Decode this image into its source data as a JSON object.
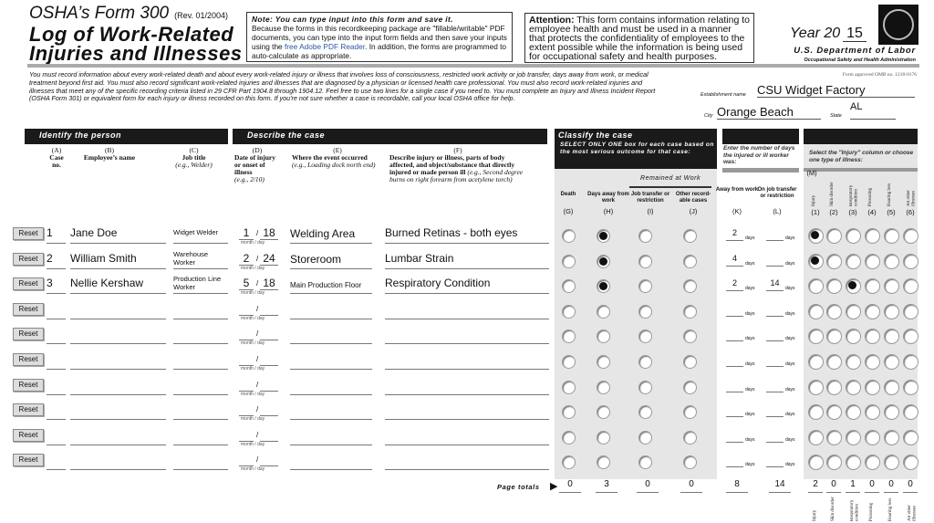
{
  "header": {
    "form_title": "OSHA’s Form 300",
    "revision": "(Rev. 01/2004)",
    "title_line1": "Log of Work-Related",
    "title_line2": "Injuries and Illnesses",
    "note_heading": "Note: You can type input into this form and save it.",
    "note_text_1": "Because the forms in this recordkeeping package are \"fillable/writable\" PDF documents, you can type into the input form fields and then save your inputs using the ",
    "note_link": "free Adobe PDF Reader",
    "note_text_2": ". In addition, the forms are programmed to auto-calculate as appropriate.",
    "attention_heading": "Attention:",
    "attention_text": " This form contains information relating to employee health and must be used in a manner that protects the confidentiality of employees to the extent possible while the information is being used for occupational safety and health purposes.",
    "year_label": "Year 20",
    "year_value": "15",
    "department": "U.S. Department of Labor",
    "agency": "Occupational Safety and Health Administration",
    "omb": "Form approved OMB no. 1218-0176"
  },
  "instructions": "You must record information about every work-related death and about every work-related injury or illness that involves loss of consciousness, restricted work activity or job transfer, days away from work, or medical treatment beyond first aid. You must also record significant work-related injuries and illnesses that are diagnosed by a physician or licensed health care professional. You must also record work-related injuries and illnesses that meet any of the specific recording criteria listed in 29 CFR Part 1904.8 through 1904.12. Feel free to use two lines for a single case if you need to. You must complete an Injury and Illness Incident Report (OSHA Form 301) or equivalent form for each injury or illness recorded on this form. If you're not sure whether a case is recordable, call your local OSHA office for help.",
  "establishment": {
    "name_label": "Establishment name",
    "name": "CSU Widget Factory",
    "city_label": "City",
    "city": "Orange Beach",
    "state_label": "State",
    "state": "AL"
  },
  "sections": {
    "identify": "Identify the person",
    "describe": "Describe the case",
    "classify": "Classify the case",
    "classify_sub": "SELECT ONLY ONE box for each case based on the most serious outcome for that case:",
    "days_sub": "Enter the number of days the injured or ill worker was:",
    "type_sub": "Select the \"Injury\" column or choose one type of illness:",
    "remained": "Remained at Work"
  },
  "columns": {
    "A": {
      "code": "(A)",
      "label": "Case no."
    },
    "B": {
      "code": "(B)",
      "label": "Employee’s name"
    },
    "C": {
      "code": "(C)",
      "label": "Job title",
      "example": "(e.g., Welder)"
    },
    "D": {
      "code": "(D)",
      "label": "Date of injury or onset of illness",
      "example": "(e.g., 2/10)"
    },
    "E": {
      "code": "(E)",
      "label": "Where the event occurred",
      "example": "(e.g., Loading dock north end)"
    },
    "F": {
      "code": "(F)",
      "label": "Describe injury or illness, parts of body affected, and object/substance that directly injured or made person ill",
      "example": "(e.g., Second degree burns on right forearm from acetylene torch)"
    },
    "G": {
      "code": "(G)",
      "label": "Death"
    },
    "H": {
      "code": "(H)",
      "label": "Days away from work"
    },
    "I": {
      "code": "(I)",
      "label": "Job transfer or restriction"
    },
    "J": {
      "code": "(J)",
      "label": "Other record-able cases"
    },
    "K": {
      "code": "(K)",
      "label": "Away from work"
    },
    "L": {
      "code": "(L)",
      "label": "On job transfer or restriction"
    },
    "M": {
      "code": "(M)",
      "types": [
        {
          "code": "(1)",
          "label": "Injury"
        },
        {
          "code": "(2)",
          "label": "Skin disorder"
        },
        {
          "code": "(3)",
          "label": "Respiratory condition"
        },
        {
          "code": "(4)",
          "label": "Poisoning"
        },
        {
          "code": "(5)",
          "label": "Hearing loss"
        },
        {
          "code": "(6)",
          "label": "All other illnesses"
        }
      ]
    }
  },
  "labels": {
    "reset": "Reset",
    "month_day": "month / day",
    "days": "days",
    "date_sep": "/",
    "page_totals": "Page totals"
  },
  "rows": [
    {
      "case": "1",
      "name": "Jane Doe",
      "job": "Widget Welder",
      "month": "1",
      "day": "18",
      "where": "Welding Area",
      "describe": "Burned Retinas - both eyes",
      "outcome": "H",
      "days_away": "2",
      "days_transfer": "",
      "type": 1
    },
    {
      "case": "2",
      "name": "William Smith",
      "job": "Warehouse Worker",
      "month": "2",
      "day": "24",
      "where": "Storeroom",
      "describe": "Lumbar Strain",
      "outcome": "H",
      "days_away": "4",
      "days_transfer": "",
      "type": 1
    },
    {
      "case": "3",
      "name": "Nellie Kershaw",
      "job": "Production Line Worker",
      "month": "5",
      "day": "18",
      "where": "Main Production Floor",
      "describe": "Respiratory Condition",
      "outcome": "H",
      "days_away": "2",
      "days_transfer": "14",
      "type": 3
    },
    {
      "case": "",
      "name": "",
      "job": "",
      "month": "",
      "day": "",
      "where": "",
      "describe": "",
      "outcome": "",
      "days_away": "",
      "days_transfer": "",
      "type": 0
    },
    {
      "case": "",
      "name": "",
      "job": "",
      "month": "",
      "day": "",
      "where": "",
      "describe": "",
      "outcome": "",
      "days_away": "",
      "days_transfer": "",
      "type": 0
    },
    {
      "case": "",
      "name": "",
      "job": "",
      "month": "",
      "day": "",
      "where": "",
      "describe": "",
      "outcome": "",
      "days_away": "",
      "days_transfer": "",
      "type": 0
    },
    {
      "case": "",
      "name": "",
      "job": "",
      "month": "",
      "day": "",
      "where": "",
      "describe": "",
      "outcome": "",
      "days_away": "",
      "days_transfer": "",
      "type": 0
    },
    {
      "case": "",
      "name": "",
      "job": "",
      "month": "",
      "day": "",
      "where": "",
      "describe": "",
      "outcome": "",
      "days_away": "",
      "days_transfer": "",
      "type": 0
    },
    {
      "case": "",
      "name": "",
      "job": "",
      "month": "",
      "day": "",
      "where": "",
      "describe": "",
      "outcome": "",
      "days_away": "",
      "days_transfer": "",
      "type": 0
    },
    {
      "case": "",
      "name": "",
      "job": "",
      "month": "",
      "day": "",
      "where": "",
      "describe": "",
      "outcome": "",
      "days_away": "",
      "days_transfer": "",
      "type": 0
    }
  ],
  "totals": {
    "G": "0",
    "H": "3",
    "I": "0",
    "J": "0",
    "K": "8",
    "L": "14",
    "types": [
      "2",
      "0",
      "1",
      "0",
      "0",
      "0"
    ]
  }
}
